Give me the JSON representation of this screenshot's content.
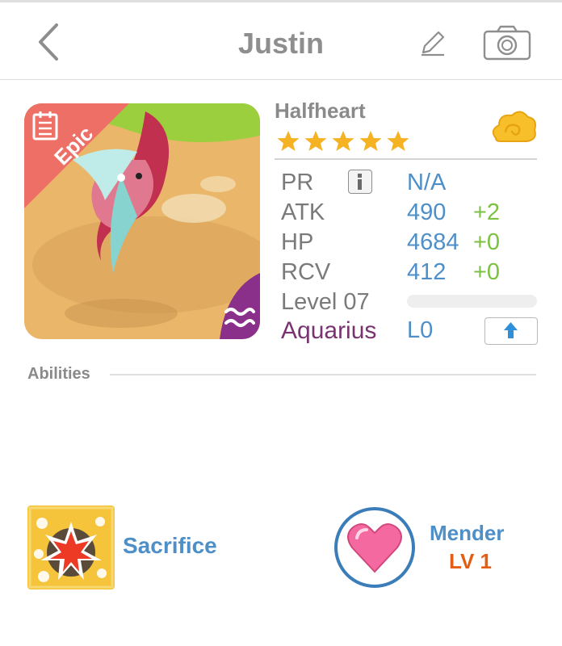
{
  "header": {
    "title": "Justin",
    "back_icon": "chevron-left-icon",
    "edit_icon": "pencil-icon",
    "camera_icon": "camera-icon"
  },
  "monster": {
    "name": "Halfheart",
    "rarity": "Epic",
    "stars": 5,
    "element_icon": "cloud-icon",
    "stats": {
      "pr": {
        "label": "PR",
        "value": "N/A"
      },
      "atk": {
        "label": "ATK",
        "value": "490",
        "bonus": "+2"
      },
      "hp": {
        "label": "HP",
        "value": "4684",
        "bonus": "+0"
      },
      "rcv": {
        "label": "RCV",
        "value": "412",
        "bonus": "+0"
      }
    },
    "level_label": "Level 07",
    "level_progress": 0,
    "sign": {
      "name": "Aquarius",
      "level": "L0"
    }
  },
  "abilities": {
    "title": "Abilities",
    "skill": {
      "name": "Sacrifice",
      "icon": "explosion-icon"
    },
    "type": {
      "name": "Mender",
      "level": "LV 1",
      "icon": "heart-icon"
    }
  },
  "colors": {
    "accent_blue": "#4e8fc8",
    "bonus_green": "#7cc142",
    "sign_purple": "#7a3370",
    "level_orange": "#e35e12",
    "star_gold": "#f5b324",
    "epic_red": "#ee6f65"
  }
}
